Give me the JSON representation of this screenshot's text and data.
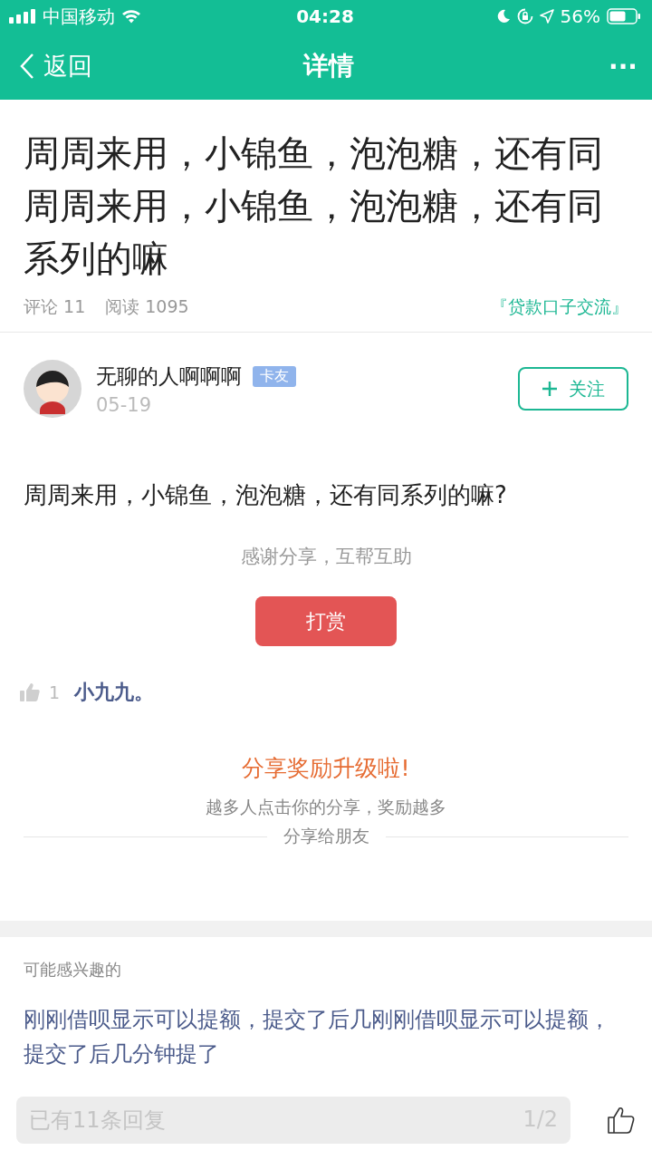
{
  "status_bar": {
    "carrier": "中国移动",
    "time": "04:28",
    "battery": "56%"
  },
  "nav": {
    "back": "返回",
    "title": "详情",
    "more": "···"
  },
  "post": {
    "title": "周周来用，小锦鱼，泡泡糖，还有同周周来用，小锦鱼，泡泡糖，还有同系列的嘛",
    "comments": "评论 11",
    "reads": "阅读 1095",
    "forum": "『贷款口子交流』"
  },
  "author": {
    "name": "无聊的人啊啊啊",
    "badge": "卡友",
    "date": "05-19",
    "follow": "关注"
  },
  "body": "周周来用，小锦鱼，泡泡糖，还有同系列的嘛?",
  "thanks": "感谢分享，互帮互助",
  "reward_button": "打赏",
  "likes": {
    "count": "1",
    "users": "小九九。"
  },
  "share": {
    "title": "分享奖励升级啦!",
    "subtitle": "越多人点击你的分享，奖励越多",
    "action": "分享给朋友"
  },
  "related": {
    "heading": "可能感兴趣的",
    "items": [
      {
        "title": "刚刚借呗显示可以提额，提交了后几刚刚借呗显示可以提额，提交了后几分钟提了"
      }
    ]
  },
  "reply_bar": {
    "placeholder": "已有11条回复",
    "page": "1/2"
  }
}
